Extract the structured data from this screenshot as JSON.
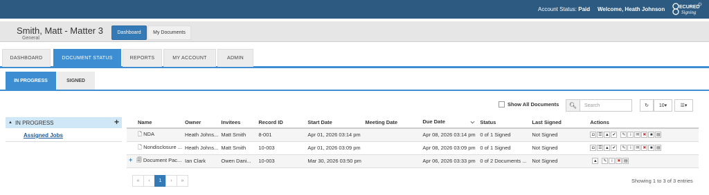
{
  "topbar": {
    "account_status_label": "Account Status:",
    "account_status_value": "Paid",
    "welcome": "Welcome, Heath Johnson",
    "logo_text": "SECURED Signing"
  },
  "matter": {
    "title": "Smith, Matt - Matter 3",
    "subtitle": "General",
    "dashboard_button": "Dashboard",
    "my_documents_button": "My Documents"
  },
  "main_tabs": [
    "DASHBOARD",
    "DOCUMENT STATUS",
    "REPORTS",
    "MY ACCOUNT",
    "ADMIN"
  ],
  "active_main_tab": "DOCUMENT STATUS",
  "sub_tabs": [
    "IN PROGRESS",
    "SIGNED"
  ],
  "toolbar": {
    "show_all_label": "Show All Documents",
    "search_placeholder": "Search",
    "page_size": "10"
  },
  "tree": {
    "header": "IN PROGRESS",
    "link": "Assigned Jobs"
  },
  "table": {
    "columns": [
      "Name",
      "Owner",
      "Invitees",
      "Record ID",
      "Start Date",
      "Meeting Date",
      "Due Date",
      "Status",
      "Last Signed",
      "Actions"
    ],
    "rows": [
      {
        "name": "NDA",
        "owner": "Heath Johns...",
        "invitees": "Matt Smith",
        "record_id": "8-001",
        "start_date": "Apr 01, 2026 03:14 pm",
        "meeting_date": "",
        "due_date": "Apr 08, 2026 03:14 pm",
        "status": "0 of 1 Signed",
        "last_signed": "Not Signed"
      },
      {
        "name": "Nondisclosure ...",
        "owner": "Heath Johns...",
        "invitees": "Matt Smith",
        "record_id": "10-003",
        "start_date": "Apr 01, 2026 03:09 pm",
        "meeting_date": "",
        "due_date": "Apr 08, 2026 03:09 pm",
        "status": "0 of 1 Signed",
        "last_signed": "Not Signed"
      },
      {
        "name": "Document Pac...",
        "owner": "Ian Clark",
        "invitees": "Owen Dani...",
        "record_id": "10-003",
        "start_date": "Mar 30, 2026 03:50 pm",
        "meeting_date": "",
        "due_date": "Apr 06, 2026 03:33 pm",
        "status": "0 of 2 Documents ...",
        "last_signed": "Not Signed"
      }
    ]
  },
  "pager": [
    "«",
    "‹",
    "1",
    "›",
    "»"
  ],
  "showing": "Showing 1 to 3 of 3 entries"
}
